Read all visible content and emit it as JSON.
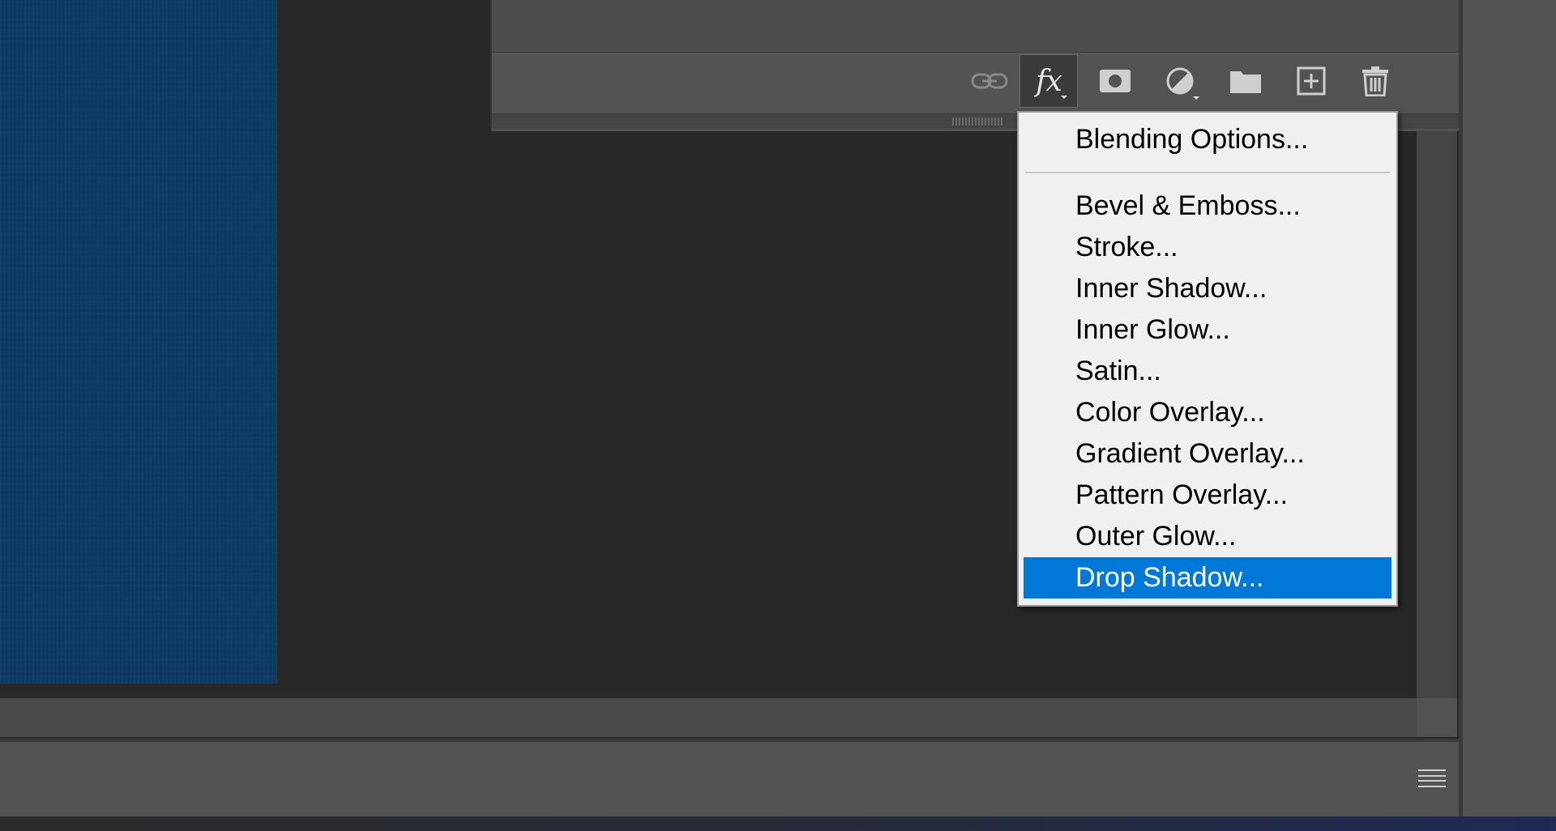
{
  "layers_footer": {
    "buttons": [
      {
        "icon": "link-icon"
      },
      {
        "icon": "fx-icon",
        "text": "fx",
        "active": true
      },
      {
        "icon": "mask-icon"
      },
      {
        "icon": "adjustment-icon"
      },
      {
        "icon": "folder-icon"
      },
      {
        "icon": "new-layer-icon"
      },
      {
        "icon": "trash-icon"
      }
    ]
  },
  "fx_menu": {
    "header_item": "Blending Options...",
    "items": [
      "Bevel & Emboss...",
      "Stroke...",
      "Inner Shadow...",
      "Inner Glow...",
      "Satin...",
      "Color Overlay...",
      "Gradient Overlay...",
      "Pattern Overlay...",
      "Outer Glow...",
      "Drop Shadow..."
    ],
    "highlighted": "Drop Shadow..."
  },
  "colors": {
    "canvas_fill": "#0b3a65",
    "highlight": "#0078d7",
    "panel": "#535353",
    "workspace": "#282828"
  },
  "bottom_panel": {
    "menu_icon": "panel-menu-icon"
  }
}
